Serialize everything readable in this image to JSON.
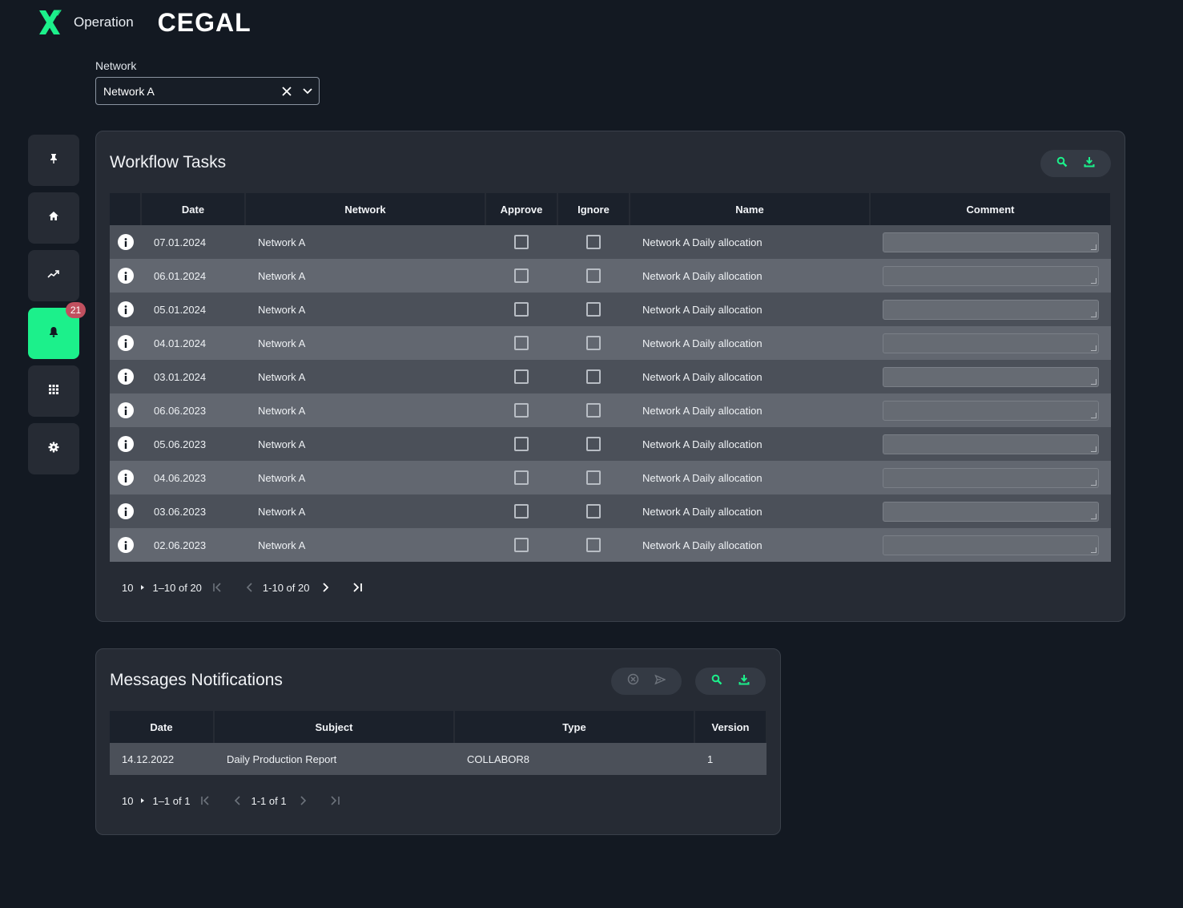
{
  "header": {
    "app_name": "Operation",
    "brand": "CEGAL"
  },
  "network_filter": {
    "label": "Network",
    "value": "Network A"
  },
  "sidebar": {
    "notification_count": "21"
  },
  "workflow": {
    "title": "Workflow Tasks",
    "columns": [
      "Date",
      "Network",
      "Approve",
      "Ignore",
      "Name",
      "Comment"
    ],
    "rows": [
      {
        "date": "07.01.2024",
        "network": "Network A",
        "name": "Network A Daily allocation"
      },
      {
        "date": "06.01.2024",
        "network": "Network A",
        "name": "Network A Daily allocation"
      },
      {
        "date": "05.01.2024",
        "network": "Network A",
        "name": "Network A Daily allocation"
      },
      {
        "date": "04.01.2024",
        "network": "Network A",
        "name": "Network A Daily allocation"
      },
      {
        "date": "03.01.2024",
        "network": "Network A",
        "name": "Network A Daily allocation"
      },
      {
        "date": "06.06.2023",
        "network": "Network A",
        "name": "Network A Daily allocation"
      },
      {
        "date": "05.06.2023",
        "network": "Network A",
        "name": "Network A Daily allocation"
      },
      {
        "date": "04.06.2023",
        "network": "Network A",
        "name": "Network A Daily allocation"
      },
      {
        "date": "03.06.2023",
        "network": "Network A",
        "name": "Network A Daily allocation"
      },
      {
        "date": "02.06.2023",
        "network": "Network A",
        "name": "Network A Daily allocation"
      }
    ],
    "pager": {
      "page_size": "10",
      "range": "1–10 of 20",
      "range2": "1-10 of 20"
    }
  },
  "messages": {
    "title": "Messages Notifications",
    "columns": [
      "Date",
      "Subject",
      "Type",
      "Version"
    ],
    "rows": [
      {
        "date": "14.12.2022",
        "subject": "Daily Production Report",
        "type": "COLLABOR8",
        "version": "1"
      }
    ],
    "pager": {
      "page_size": "10",
      "range": "1–1 of 1",
      "range2": "1-1 of 1"
    }
  },
  "colors": {
    "accent": "#1cf08b",
    "badge": "#c0505f",
    "background": "#131922",
    "card": "#262b34"
  }
}
